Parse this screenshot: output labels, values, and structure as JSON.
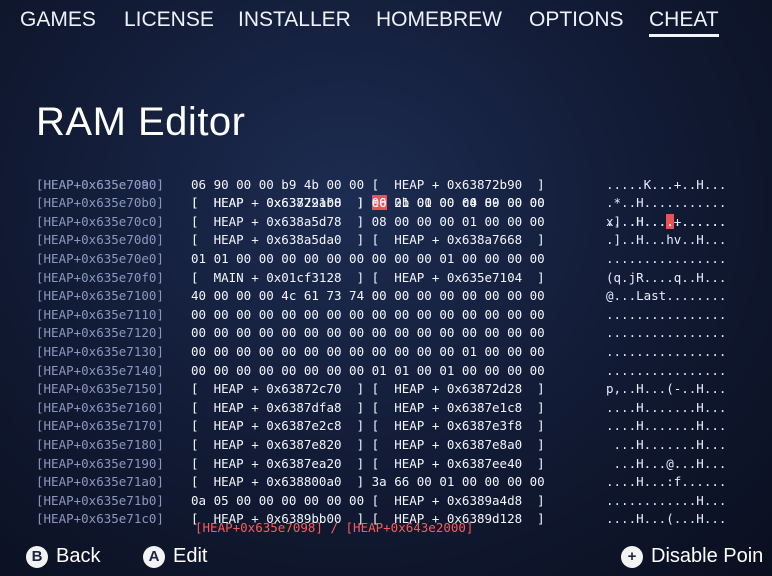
{
  "tabs": [
    {
      "label": "GAMES",
      "active": false
    },
    {
      "label": "LICENSE",
      "active": false
    },
    {
      "label": "INSTALLER",
      "active": false
    },
    {
      "label": "HOMEBREW",
      "active": false
    },
    {
      "label": "OPTIONS",
      "active": false
    },
    {
      "label": "CHEAT",
      "active": true
    }
  ],
  "title": "RAM Editor",
  "rows": [
    {
      "addr": "[HEAP+0x635e7090]",
      "hex_pre": "[  HEAP + 0x63729108  ] ",
      "hex_hl": "e6",
      "hex_post": " 2b 00 00 c4 89 00 00",
      "ascii_pre": "....H...",
      "ascii_hl": ".",
      "ascii_post": "+......"
    },
    {
      "addr": "[HEAP+0x635e70a0]",
      "hex": "06 90 00 00 b9 4b 00 00 [  HEAP + 0x63872b90  ]",
      "ascii": ".....K...+..H..."
    },
    {
      "addr": "[HEAP+0x635e70b0]",
      "hex": "[  HEAP + 0x63872ab0  ] 00 01 01 00 00 00 00 00",
      "ascii": ".*..H..........."
    },
    {
      "addr": "[HEAP+0x635e70c0]",
      "hex": "[  HEAP + 0x638a5d78  ] 08 00 00 00 01 00 00 00",
      "ascii": "x]..H..........."
    },
    {
      "addr": "[HEAP+0x635e70d0]",
      "hex": "[  HEAP + 0x638a5da0  ] [  HEAP + 0x638a7668  ]",
      "ascii": ".]..H...hv..H..."
    },
    {
      "addr": "[HEAP+0x635e70e0]",
      "hex": "01 01 00 00 00 00 00 00 00 00 00 01 00 00 00 00",
      "ascii": "................"
    },
    {
      "addr": "[HEAP+0x635e70f0]",
      "hex": "[  MAIN + 0x01cf3128  ] [  HEAP + 0x635e7104  ]",
      "ascii": "(q.jR....q..H..."
    },
    {
      "addr": "[HEAP+0x635e7100]",
      "hex": "40 00 00 00 4c 61 73 74 00 00 00 00 00 00 00 00",
      "ascii": "@...Last........"
    },
    {
      "addr": "[HEAP+0x635e7110]",
      "hex": "00 00 00 00 00 00 00 00 00 00 00 00 00 00 00 00",
      "ascii": "................"
    },
    {
      "addr": "[HEAP+0x635e7120]",
      "hex": "00 00 00 00 00 00 00 00 00 00 00 00 00 00 00 00",
      "ascii": "................"
    },
    {
      "addr": "[HEAP+0x635e7130]",
      "hex": "00 00 00 00 00 00 00 00 00 00 00 00 01 00 00 00",
      "ascii": "................"
    },
    {
      "addr": "[HEAP+0x635e7140]",
      "hex": "00 00 00 00 00 00 00 00 01 01 00 01 00 00 00 00",
      "ascii": "................"
    },
    {
      "addr": "[HEAP+0x635e7150]",
      "hex": "[  HEAP + 0x63872c70  ] [  HEAP + 0x63872d28  ]",
      "ascii": "p,..H...(-..H..."
    },
    {
      "addr": "[HEAP+0x635e7160]",
      "hex": "[  HEAP + 0x6387dfa8  ] [  HEAP + 0x6387e1c8  ]",
      "ascii": "....H.......H..."
    },
    {
      "addr": "[HEAP+0x635e7170]",
      "hex": "[  HEAP + 0x6387e2c8  ] [  HEAP + 0x6387e3f8  ]",
      "ascii": "....H.......H..."
    },
    {
      "addr": "[HEAP+0x635e7180]",
      "hex": "[  HEAP + 0x6387e820  ] [  HEAP + 0x6387e8a0  ]",
      "ascii": " ...H.......H..."
    },
    {
      "addr": "[HEAP+0x635e7190]",
      "hex": "[  HEAP + 0x6387ea20  ] [  HEAP + 0x6387ee40  ]",
      "ascii": " ...H...@...H..."
    },
    {
      "addr": "[HEAP+0x635e71a0]",
      "hex": "[  HEAP + 0x638800a0  ] 3a 66 00 01 00 00 00 00",
      "ascii": "....H...:f......"
    },
    {
      "addr": "[HEAP+0x635e71b0]",
      "hex": "0a 05 00 00 00 00 00 00 [  HEAP + 0x6389a4d8  ]",
      "ascii": "............H..."
    },
    {
      "addr": "[HEAP+0x635e71c0]",
      "hex": "[  HEAP + 0x6389bb00  ] [  HEAP + 0x6389d128  ]",
      "ascii": "....H...(...H..."
    }
  ],
  "range_text": "[HEAP+0x635e7098] / [HEAP+0x643e2000]",
  "footer": {
    "back_icon": "B",
    "back_label": "Back",
    "edit_icon": "A",
    "edit_label": "Edit",
    "disable_icon": "+",
    "disable_label": "Disable Poin"
  },
  "colors": {
    "highlight": "#e85454",
    "range_text": "#ff5a5a",
    "address": "#8c97bf"
  }
}
